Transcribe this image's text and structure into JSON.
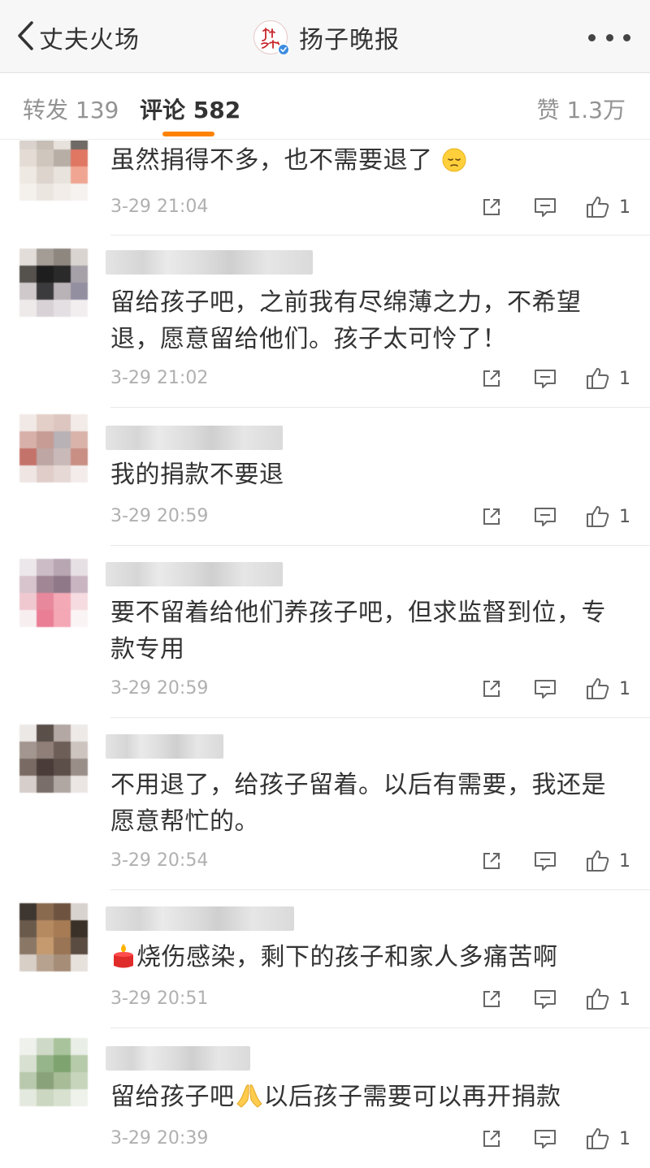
{
  "nav": {
    "back_label": "丈夫火场",
    "account_name": "扬子晚报",
    "logo_text": "扬子晚报"
  },
  "tabs": {
    "repost": "转发 139",
    "comments": "评论 582",
    "likes": "赞 1.3万"
  },
  "comments": [
    {
      "text": "虽然捐得不多，也不需要退了",
      "emoji": "pensive-face",
      "time": "3-29 21:04",
      "likes": "1"
    },
    {
      "text": "留给孩子吧，之前我有尽绵薄之力，不希望退，愿意留给他们。孩子太可怜了！",
      "time": "3-29 21:02",
      "likes": "1"
    },
    {
      "text": "我的捐款不要退",
      "time": "3-29 20:59",
      "likes": "1"
    },
    {
      "text": "要不留着给他们养孩子吧，但求监督到位，专款专用",
      "time": "3-29 20:59",
      "likes": "1"
    },
    {
      "text": "不用退了，给孩子留着。以后有需要，我还是愿意帮忙的。",
      "time": "3-29 20:54",
      "likes": "1"
    },
    {
      "text": "烧伤感染，剩下的孩子和家人多痛苦啊",
      "emoji": "candle",
      "time": "3-29 20:51",
      "likes": "1"
    },
    {
      "text_a": "留给孩子吧",
      "emoji": "folded-hands",
      "text_b": "以后孩子需要可以再开捐款",
      "time": "3-29 20:39",
      "likes": "1"
    }
  ],
  "colors": {
    "accent": "#ff8200",
    "text": "#333333",
    "muted": "#939393",
    "time": "#b0b0b0"
  }
}
